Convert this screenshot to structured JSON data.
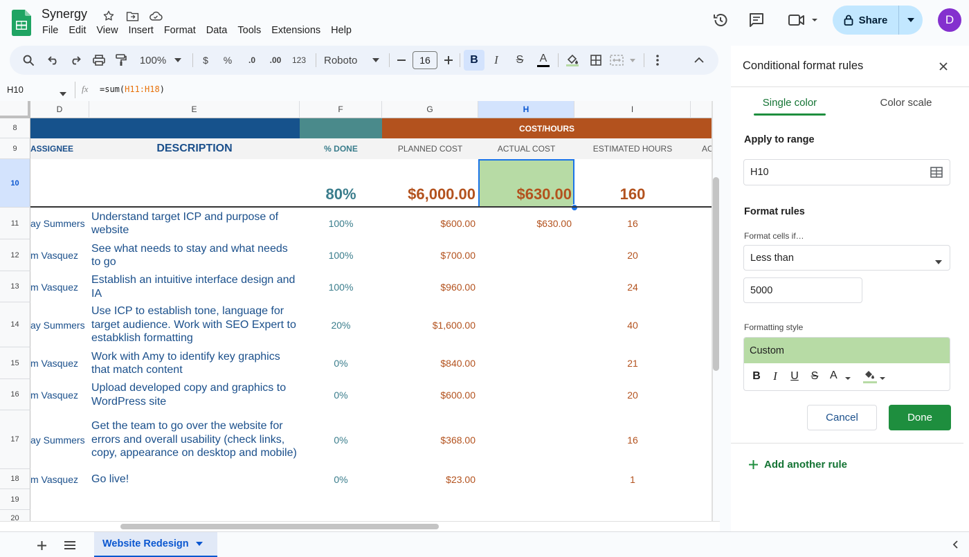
{
  "app": {
    "title": "Synergy",
    "menu": [
      "File",
      "Edit",
      "View",
      "Insert",
      "Format",
      "Data",
      "Tools",
      "Extensions",
      "Help"
    ],
    "share_label": "Share",
    "avatar_letter": "D"
  },
  "toolbar": {
    "zoom": "100%",
    "currency": "$",
    "percent": "%",
    "dec_less": ".0",
    "dec_more": ".00",
    "number_format": "123",
    "font": "Roboto",
    "font_size": "16",
    "bold": "B",
    "italic": "I",
    "strike": "S",
    "text_color": "A"
  },
  "formula_bar": {
    "cell_ref": "H10",
    "fx": "fx",
    "formula_prefix": "=sum(",
    "formula_range": "H11:H18",
    "formula_suffix": ")"
  },
  "grid": {
    "columns": [
      "D",
      "E",
      "F",
      "G",
      "H",
      "I"
    ],
    "row_numbers": [
      "8",
      "9",
      "10",
      "11",
      "12",
      "13",
      "14",
      "15",
      "16",
      "17",
      "18",
      "19",
      "20"
    ],
    "banner_text": "COST/HOURS",
    "headers": {
      "assignee": "ASSIGNEE",
      "description": "DESCRIPTION",
      "pct_done": "% DONE",
      "planned": "PLANNED COST",
      "actual": "ACTUAL COST",
      "hours": "ESTIMATED HOURS",
      "next": "AC"
    },
    "totals": {
      "pct": "80%",
      "planned": "$6,000.00",
      "actual": "$630.00",
      "hours": "160"
    },
    "rows": [
      {
        "assignee": "ay Summers",
        "desc": "Understand target ICP and purpose of website",
        "pct": "100%",
        "planned": "$600.00",
        "actual": "$630.00",
        "hours": "16"
      },
      {
        "assignee": "m Vasquez",
        "desc": "See what needs to stay and what needs to go",
        "pct": "100%",
        "planned": "$700.00",
        "actual": "",
        "hours": "20"
      },
      {
        "assignee": "m Vasquez",
        "desc": "Establish an intuitive interface design and IA",
        "pct": "100%",
        "planned": "$960.00",
        "actual": "",
        "hours": "24"
      },
      {
        "assignee": "ay Summers",
        "desc": "Use ICP to establish tone, language for target audience. Work with SEO Expert to estabklish formatting",
        "pct": "20%",
        "planned": "$1,600.00",
        "actual": "",
        "hours": "40"
      },
      {
        "assignee": "m Vasquez",
        "desc": "Work with Amy to identify key graphics that match content",
        "pct": "0%",
        "planned": "$840.00",
        "actual": "",
        "hours": "21"
      },
      {
        "assignee": "m Vasquez",
        "desc": "Upload developed copy and graphics to WordPress site",
        "pct": "0%",
        "planned": "$600.00",
        "actual": "",
        "hours": "20"
      },
      {
        "assignee": "ay Summers",
        "desc": "Get the team to go over the website for errors and overall usability (check links, copy, appearance on desktop and mobile)",
        "pct": "0%",
        "planned": "$368.00",
        "actual": "",
        "hours": "16"
      },
      {
        "assignee": "m Vasquez",
        "desc": "Go live!",
        "pct": "0%",
        "planned": "$23.00",
        "actual": "",
        "hours": "1"
      }
    ]
  },
  "sheets": {
    "active": "Website Redesign"
  },
  "panel": {
    "title": "Conditional format rules",
    "tab_single": "Single color",
    "tab_scale": "Color scale",
    "apply_label": "Apply to range",
    "range_value": "H10",
    "format_rules_label": "Format rules",
    "format_if_label": "Format cells if…",
    "condition": "Less than",
    "value": "5000",
    "style_label": "Formatting style",
    "style_preview": "Custom",
    "cancel": "Cancel",
    "done": "Done",
    "add_rule": "Add another rule"
  },
  "colors": {
    "accent": "#0b57d0",
    "blue_banner": "#16528c",
    "teal_banner": "#4a8a8b",
    "orange_banner": "#b3521e",
    "highlight_green": "#b7dba5",
    "done_green": "#1e8e3e"
  }
}
